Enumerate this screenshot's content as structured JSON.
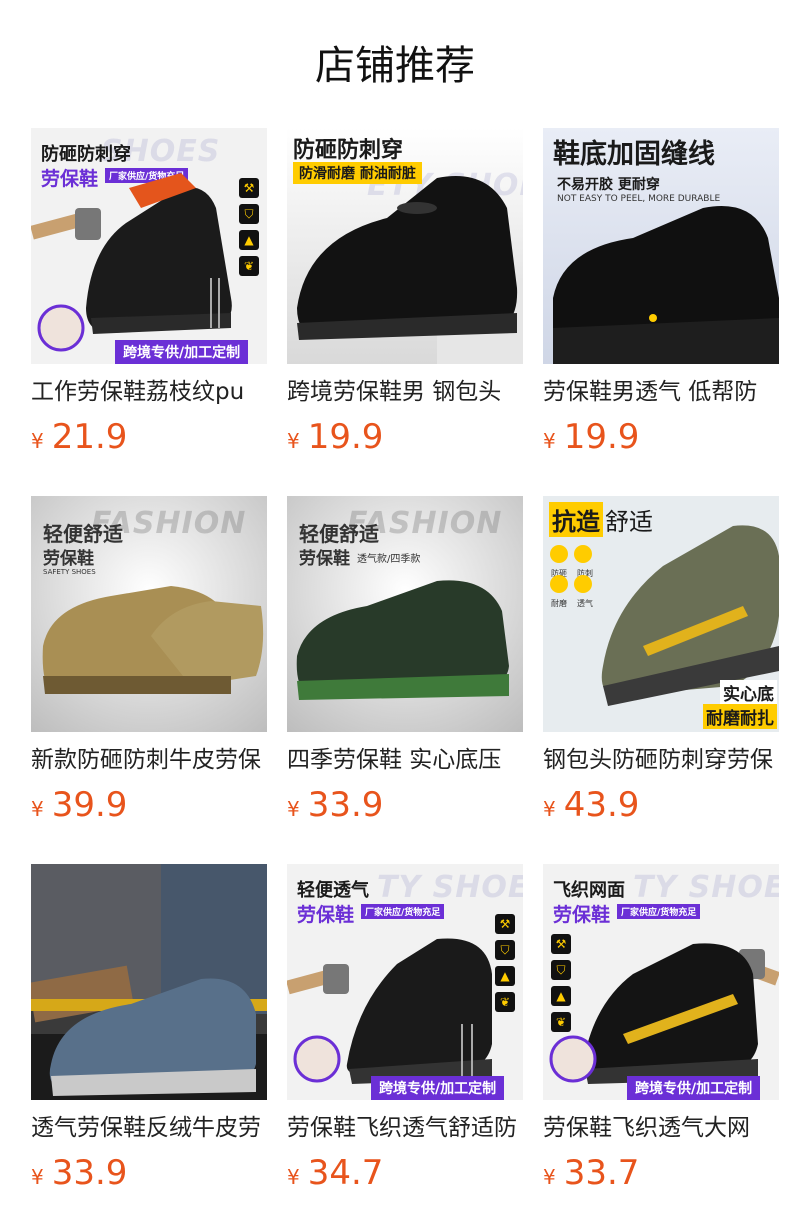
{
  "page_title": "店铺推荐",
  "products": [
    {
      "name": "工作劳保鞋荔枝纹pu",
      "currency": "¥",
      "price": "21.9",
      "image": {
        "headline1": "防砸防刺穿",
        "headline2": "劳保鞋",
        "note": "厂家供应/货物充足",
        "ghost": "SHOES",
        "banner": "跨境专供/加工定制",
        "icons": [
          "hammer-icon",
          "shield-icon",
          "boot-icon",
          "leaf-icon"
        ]
      }
    },
    {
      "name": "跨境劳保鞋男 钢包头",
      "currency": "¥",
      "price": "19.9",
      "image": {
        "headline1": "防砸防刺穿",
        "tag": "防滑耐磨 耐油耐脏",
        "ghost": "ETY SHOES"
      }
    },
    {
      "name": "劳保鞋男透气 低帮防",
      "currency": "¥",
      "price": "19.9",
      "image": {
        "headline1": "鞋底加固缝线",
        "headline2": "不易开胶 更耐穿",
        "note": "NOT EASY TO PEEL, MORE DURABLE"
      }
    },
    {
      "name": "新款防砸防刺牛皮劳保",
      "currency": "¥",
      "price": "39.9",
      "image": {
        "headline1": "轻便舒适",
        "headline2": "劳保鞋",
        "note": "SAFETY SHOES",
        "ghost": "FASHION"
      }
    },
    {
      "name": "四季劳保鞋 实心底压",
      "currency": "¥",
      "price": "33.9",
      "image": {
        "headline1": "轻便舒适",
        "headline2": "劳保鞋",
        "note2": "透气款/四季款",
        "ghost": "FASHION"
      }
    },
    {
      "name": "钢包头防砸防刺穿劳保",
      "currency": "¥",
      "price": "43.9",
      "image": {
        "headline1a": "抗造",
        "headline1b": "舒适",
        "features": [
          "防砸",
          "防刺",
          "耐磨",
          "透气"
        ],
        "badge1": "实心底",
        "badge2": "耐磨耐扎"
      }
    },
    {
      "name": "透气劳保鞋反绒牛皮劳",
      "currency": "¥",
      "price": "33.9",
      "image": {}
    },
    {
      "name": "劳保鞋飞织透气舒适防",
      "currency": "¥",
      "price": "34.7",
      "image": {
        "headline1": "轻便透气",
        "headline2": "劳保鞋",
        "note": "厂家供应/货物充足",
        "ghost": "TY SHOES",
        "banner": "跨境专供/加工定制"
      }
    },
    {
      "name": "劳保鞋飞织透气大网",
      "currency": "¥",
      "price": "33.7",
      "image": {
        "headline1": "飞织网面",
        "headline2": "劳保鞋",
        "note": "厂家供应/货物充足",
        "ghost": "TY SHOES",
        "banner": "跨境专供/加工定制"
      }
    }
  ],
  "colors": {
    "price": "#e8541c",
    "accent_purple": "#6b2fd6",
    "accent_yellow": "#ffcc00"
  }
}
